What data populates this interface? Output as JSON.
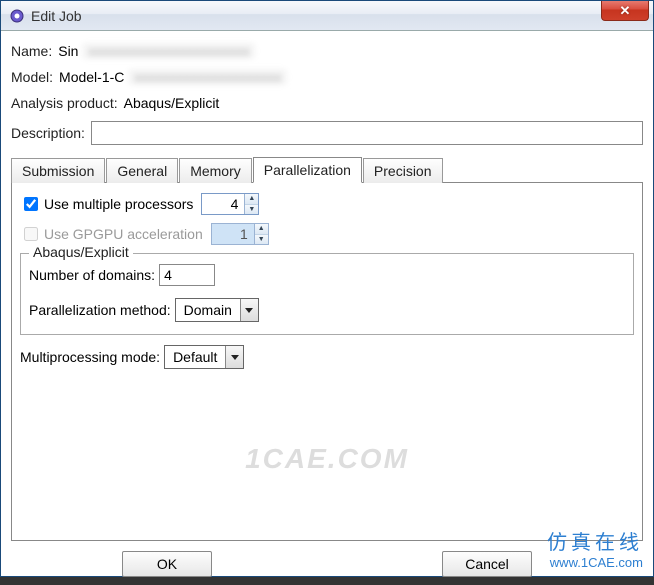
{
  "window": {
    "title": "Edit Job"
  },
  "fields": {
    "name_label": "Name:",
    "name_value": "Sin",
    "model_label": "Model:",
    "model_value": "Model-1-C",
    "analysis_label": "Analysis product:",
    "analysis_value": "Abaqus/Explicit",
    "desc_label": "Description:",
    "desc_value": ""
  },
  "tabs": [
    "Submission",
    "General",
    "Memory",
    "Parallelization",
    "Precision"
  ],
  "active_tab": "Parallelization",
  "parallel": {
    "use_multi_label": "Use multiple processors",
    "use_multi_checked": true,
    "processors": 4,
    "use_gpgpu_label": "Use GPGPU acceleration",
    "use_gpgpu_checked": false,
    "gpgpu_count": 1,
    "group_legend": "Abaqus/Explicit",
    "domains_label": "Number of domains:",
    "domains_value": 4,
    "method_label": "Parallelization method:",
    "method_value": "Domain",
    "mode_label": "Multiprocessing mode:",
    "mode_value": "Default"
  },
  "buttons": {
    "ok": "OK",
    "cancel": "Cancel"
  },
  "watermark": {
    "cn": "仿真在线",
    "url": "www.1CAE.com",
    "bg": "1CAE.COM"
  }
}
